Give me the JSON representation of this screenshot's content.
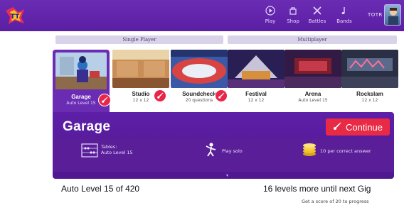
{
  "nav": {
    "items": [
      {
        "label": "Play",
        "icon": "play-icon"
      },
      {
        "label": "Shop",
        "icon": "shop-icon"
      },
      {
        "label": "Battles",
        "icon": "battles-icon"
      },
      {
        "label": "Bands",
        "icon": "bands-icon"
      }
    ],
    "username": "TOTR"
  },
  "groups": {
    "single": "Single Player",
    "multi": "Multiplayer"
  },
  "venues": [
    {
      "name": "Garage",
      "sub": "Auto Level 15",
      "selected": true,
      "badge": true
    },
    {
      "name": "Studio",
      "sub": "12 x 12",
      "badge": true
    },
    {
      "name": "Soundcheck",
      "sub": "20 questions",
      "badge": true
    },
    {
      "name": "Festival",
      "sub": "12 x 12"
    },
    {
      "name": "Arena",
      "sub": "Auto Level 15"
    },
    {
      "name": "Rockslam",
      "sub": "12 x 12"
    }
  ],
  "panel": {
    "title": "Garage",
    "continue_label": "Continue",
    "tables_title": "Tables:",
    "tables_value": "Auto Level 15",
    "mode": "Play solo",
    "reward": "10 per correct answer"
  },
  "footer": {
    "level": "Auto Level 15 of 420",
    "remaining": "16 levels more until next Gig",
    "hint": "Get a score of 20 to progress"
  },
  "colors": {
    "brand_purple": "#5a1ea3",
    "continue_red": "#e92a45",
    "badge_red": "#e8264a"
  }
}
